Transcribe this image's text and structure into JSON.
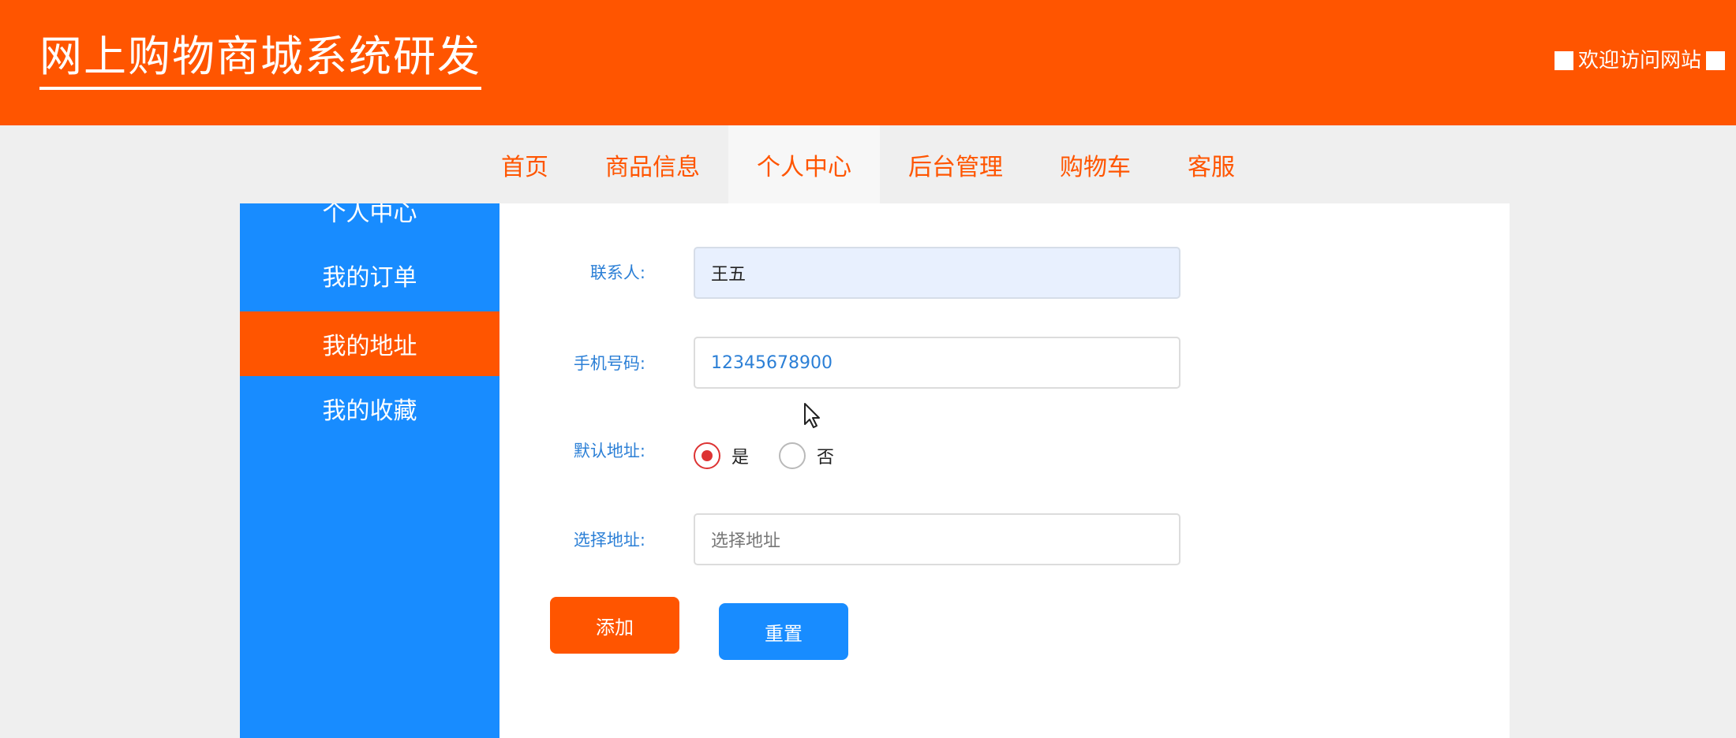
{
  "header": {
    "title": "网上购物商城系统研发",
    "welcome": "欢迎访问网站"
  },
  "nav": {
    "items": [
      {
        "label": "首页"
      },
      {
        "label": "商品信息"
      },
      {
        "label": "个人中心",
        "active": true
      },
      {
        "label": "后台管理"
      },
      {
        "label": "购物车"
      },
      {
        "label": "客服"
      }
    ]
  },
  "sidebar": {
    "items": [
      {
        "label": "个人中心"
      },
      {
        "label": "我的订单"
      },
      {
        "label": "我的地址",
        "active": true
      },
      {
        "label": "我的收藏"
      }
    ]
  },
  "form": {
    "contact": {
      "label": "联系人:",
      "value": "王五"
    },
    "phone": {
      "label": "手机号码:",
      "value": "12345678900"
    },
    "default_address": {
      "label": "默认地址:",
      "options": [
        {
          "label": "是",
          "checked": true
        },
        {
          "label": "否",
          "checked": false
        }
      ]
    },
    "address": {
      "label": "选择地址:",
      "placeholder": "选择地址"
    },
    "add_button": "添加",
    "reset_button": "重置"
  },
  "colors": {
    "brand": "#ff5500",
    "accent": "#188cff",
    "label": "#2b7fd6"
  }
}
